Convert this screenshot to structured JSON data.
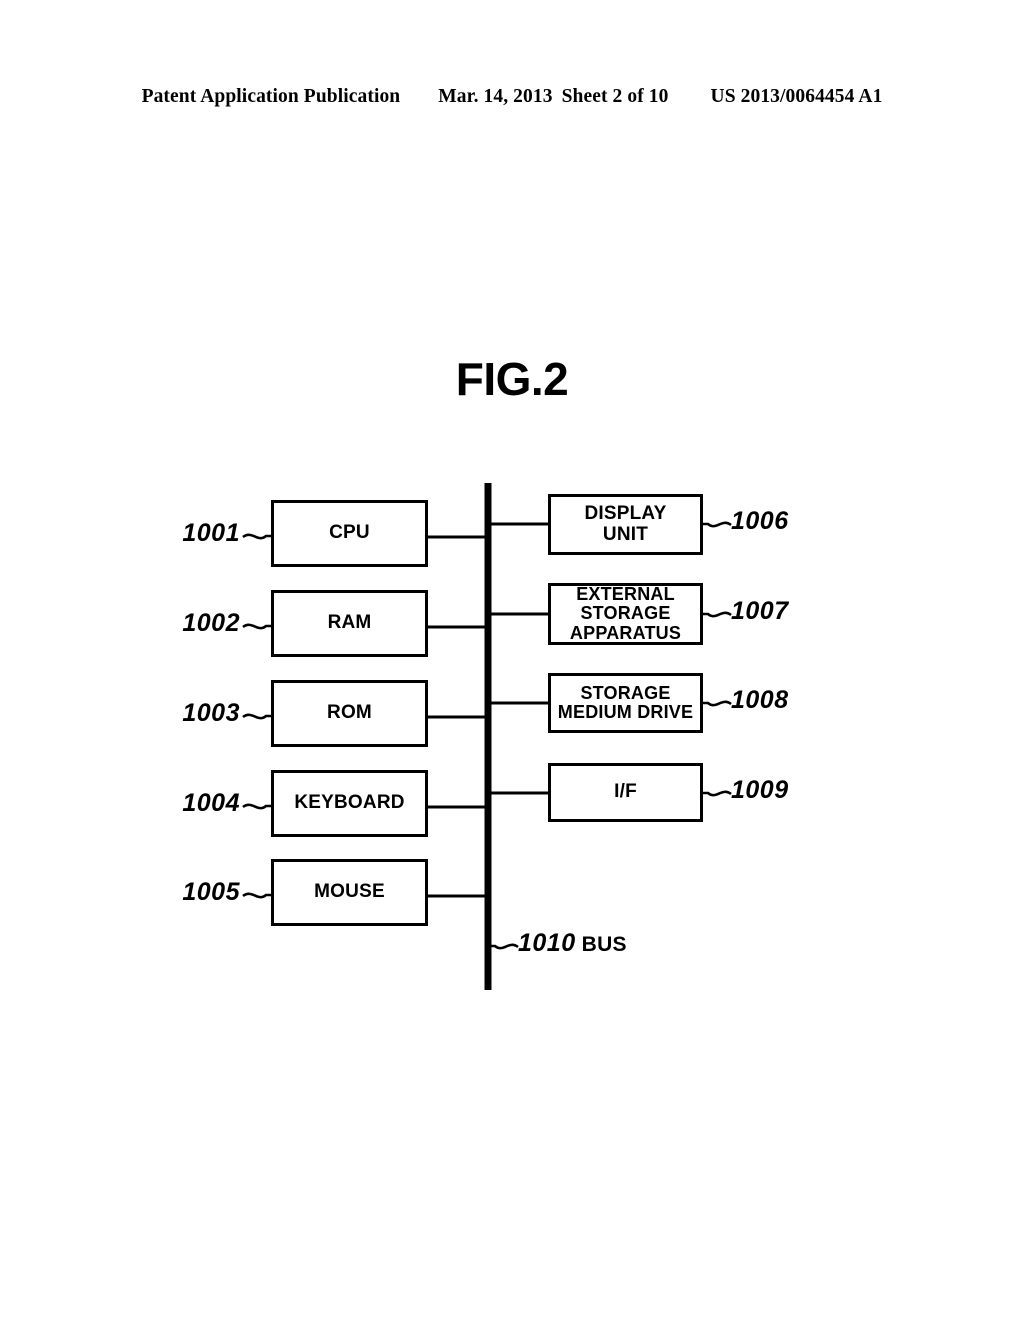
{
  "header": {
    "publication": "Patent Application Publication",
    "date": "Mar. 14, 2013",
    "sheet": "Sheet 2 of 10",
    "number": "US 2013/0064454 A1"
  },
  "figure": {
    "title": "FIG.2",
    "left_column": [
      {
        "ref": "1001",
        "label": "CPU"
      },
      {
        "ref": "1002",
        "label": "RAM"
      },
      {
        "ref": "1003",
        "label": "ROM"
      },
      {
        "ref": "1004",
        "label": "KEYBOARD"
      },
      {
        "ref": "1005",
        "label": "MOUSE"
      }
    ],
    "right_column": [
      {
        "ref": "1006",
        "label": "DISPLAY\nUNIT"
      },
      {
        "ref": "1007",
        "label": "EXTERNAL\nSTORAGE\nAPPARATUS"
      },
      {
        "ref": "1008",
        "label": "STORAGE\nMEDIUM DRIVE"
      },
      {
        "ref": "1009",
        "label": "I/F"
      }
    ],
    "bus": {
      "ref": "1010",
      "label": "BUS"
    }
  }
}
